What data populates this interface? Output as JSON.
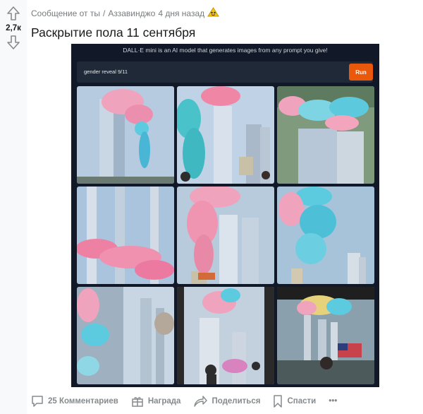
{
  "vote": {
    "score": "2,7к"
  },
  "post": {
    "source": "Сообщение от ты",
    "separator": "/",
    "author": "Аззавинджо",
    "time": "4 дня назад",
    "title": "Раскрытие пола 11 сентября"
  },
  "image": {
    "header": "DALL·E mini is an AI model that generates images from any prompt you give!",
    "prompt": "gender reveal 9/11",
    "run_label": "Run"
  },
  "actions": {
    "comments": "25 Комментариев",
    "award": "Награда",
    "share": "Поделиться",
    "save": "Спасти",
    "more": "•••"
  },
  "colors": {
    "accent": "#ea580c",
    "pink": "#f0a3bd",
    "blue": "#5ccbe0",
    "sky": "#a9c4dc"
  }
}
